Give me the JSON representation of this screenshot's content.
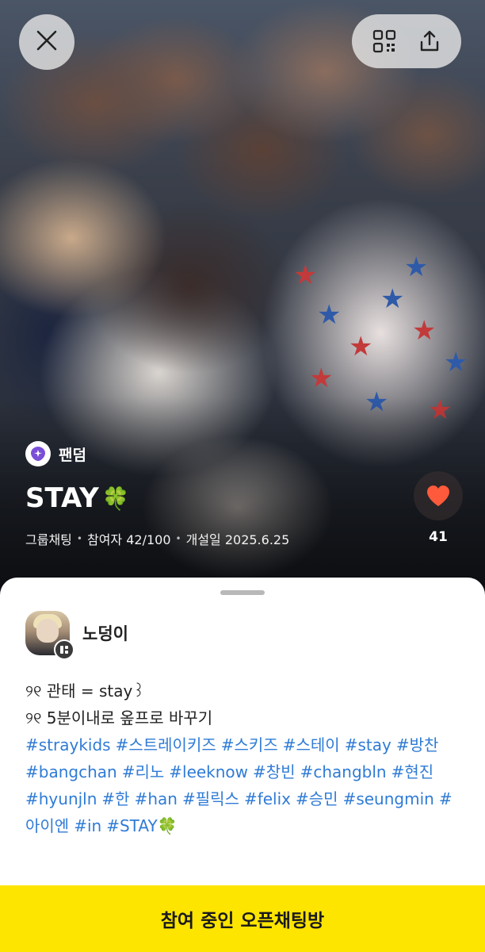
{
  "hero": {
    "category_label": "팬덤",
    "title": "STAY",
    "title_emoji": "🍀",
    "meta": {
      "type": "그룹채팅",
      "participants": "참여자 42/100",
      "created": "개설일 2025.6.25"
    },
    "like_count": "41",
    "colors": {
      "heart": "#ff5a3c",
      "badge": "#7a4fd8"
    }
  },
  "header": {
    "close_icon": "close-icon",
    "qr_icon": "qr-code-icon",
    "share_icon": "share-icon"
  },
  "host": {
    "name": "노덩이"
  },
  "description": {
    "line1": "୨୧ 관태 = stay꒱",
    "line2": "୨୧ 5분이내로 옾프로 바꾸기",
    "tags_line1": [
      "#straykids",
      "#스트레이키즈",
      "#스키즈",
      "#스테이",
      "#stay",
      "#방찬"
    ],
    "tags_line2": [
      "#bangchan",
      "#리노",
      "#leeknow",
      "#창빈",
      "#changbln",
      "#현진"
    ],
    "tags_line3": [
      "#hyunjln",
      "#한",
      "#han",
      "#필릭스",
      "#felix",
      "#승민",
      "#seungmin",
      "#"
    ],
    "tags_line4": [
      "아이엔",
      "#in",
      "#STAY🍀"
    ],
    "tag_color": "#2f7bd6"
  },
  "cta": {
    "label": "참여 중인 오픈채팅방",
    "color": "#fee500"
  }
}
